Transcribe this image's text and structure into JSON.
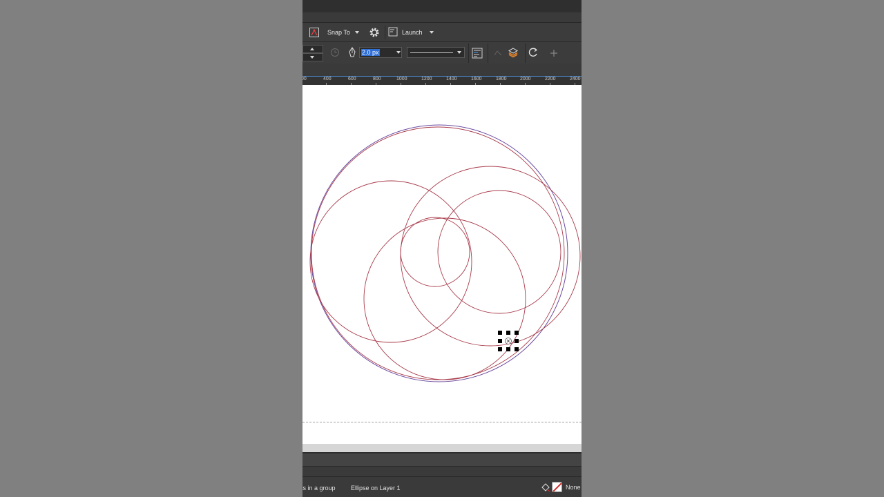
{
  "toolbar": {
    "snap_label": "Snap To",
    "launch_label": "Launch",
    "outline_width": "2.0 px"
  },
  "ruler": {
    "labels": [
      "00",
      "400",
      "600",
      "800",
      "1000",
      "1200",
      "1400",
      "1600",
      "1800",
      "2000",
      "2200",
      "2400"
    ]
  },
  "status": {
    "selection_info": "ts in a group",
    "object_info": "Ellipse on Layer 1",
    "outline_color": "None"
  },
  "colors": {
    "app_bg": "#3a3a3a",
    "canvas": "#ffffff",
    "ellipse_stroke": "#a83a4a",
    "ellipse_stroke_alt": "#6a4aa0",
    "selection_accent": "#2f6fd6"
  }
}
